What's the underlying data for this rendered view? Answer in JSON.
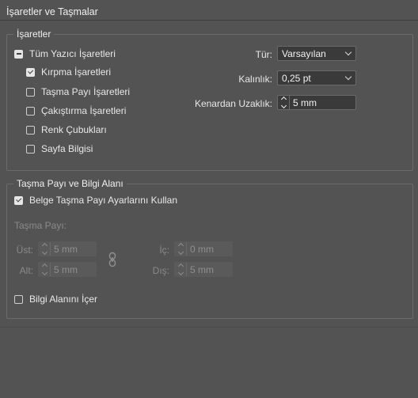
{
  "dialog": {
    "title": "İşaretler ve Taşmalar"
  },
  "marks": {
    "legend": "İşaretler",
    "all_printer_marks": "Tüm Yazıcı İşaretleri",
    "items": [
      {
        "label": "Kırpma İşaretleri",
        "checked": true
      },
      {
        "label": "Taşma Payı İşaretleri",
        "checked": false
      },
      {
        "label": "Çakıştırma İşaretleri",
        "checked": false
      },
      {
        "label": "Renk Çubukları",
        "checked": false
      },
      {
        "label": "Sayfa Bilgisi",
        "checked": false
      }
    ],
    "type_label": "Tür:",
    "type_value": "Varsayılan",
    "weight_label": "Kalınlık:",
    "weight_value": "0,25 pt",
    "offset_label": "Kenardan Uzaklık:",
    "offset_value": "5 mm"
  },
  "bleed": {
    "legend": "Taşma Payı ve Bilgi Alanı",
    "use_document_label": "Belge Taşma Payı Ayarlarını Kullan",
    "bleed_label": "Taşma Payı:",
    "top_label": "Üst:",
    "top_value": "5 mm",
    "bottom_label": "Alt:",
    "bottom_value": "5 mm",
    "inside_label": "İç:",
    "inside_value": "0 mm",
    "outside_label": "Dış:",
    "outside_value": "5 mm",
    "include_slug_label": "Bilgi Alanını İçer"
  }
}
